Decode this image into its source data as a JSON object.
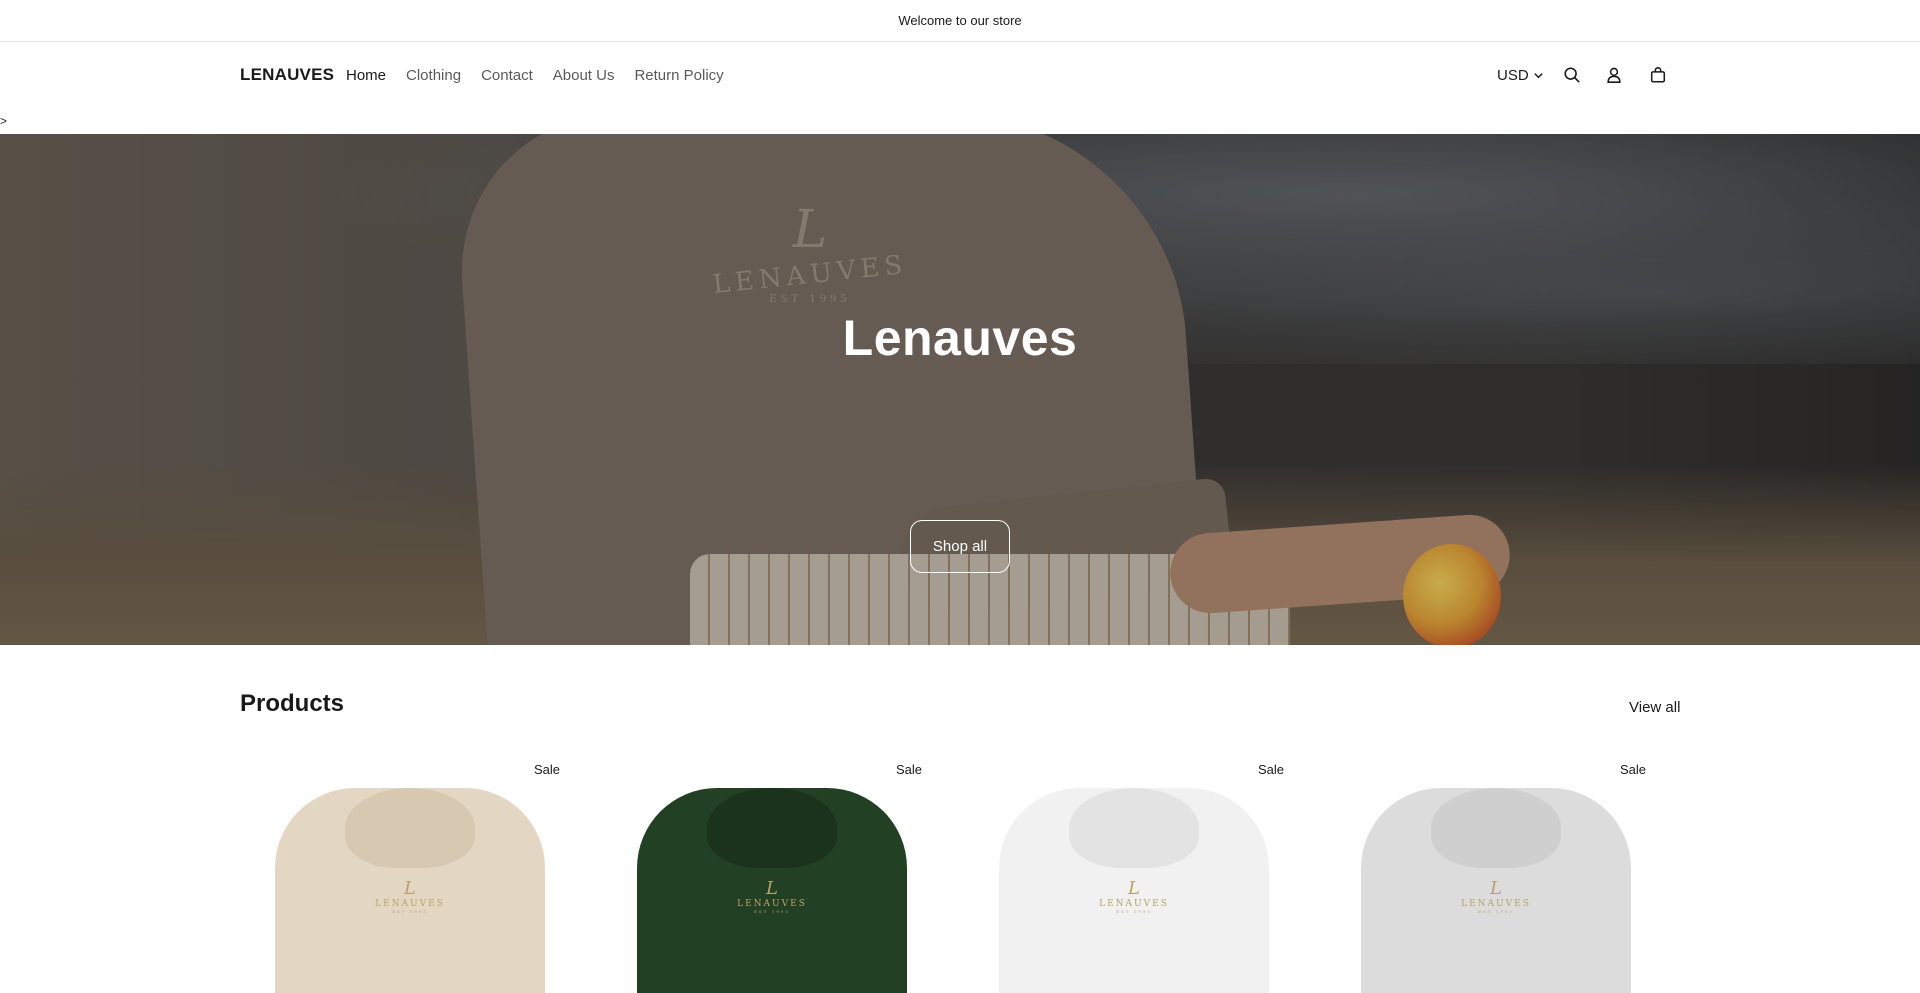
{
  "announcement": {
    "text": "Welcome to our store"
  },
  "header": {
    "logo": "LENAUVES",
    "nav": [
      "Home",
      "Clothing",
      "Contact",
      "About Us",
      "Return Policy"
    ],
    "currency": "USD",
    "icons": [
      "search-icon",
      "account-icon",
      "cart-icon"
    ]
  },
  "stray_text": ">",
  "hero": {
    "title": "Lenauves",
    "button": "Shop all",
    "garment_print": {
      "initial": "L",
      "word": "LENAUVES",
      "established": "EST 1995"
    }
  },
  "products": {
    "title": "Products",
    "view_all": "View all",
    "items": [
      {
        "badge": "Sale",
        "color": "#e3d7c3",
        "hood": "#d6c8b1",
        "mark": {
          "initial": "L",
          "word": "LENAUVES",
          "established": "EST 1995"
        }
      },
      {
        "badge": "Sale",
        "color": "#224024",
        "hood": "#1b331d",
        "mark": {
          "initial": "L",
          "word": "LENAUVES",
          "established": "EST 1995"
        }
      },
      {
        "badge": "Sale",
        "color": "#f1f1f1",
        "hood": "#e3e3e3",
        "mark": {
          "initial": "L",
          "word": "LENAUVES",
          "established": "EST 1995"
        }
      },
      {
        "badge": "Sale",
        "color": "#dcdcdc",
        "hood": "#cfcfcf",
        "mark": {
          "initial": "L",
          "word": "LENAUVES",
          "established": "EST 1995"
        }
      }
    ]
  },
  "colors": {
    "text": "#121212",
    "muted": "#5a5a5a",
    "border": "#e6e6e6"
  }
}
